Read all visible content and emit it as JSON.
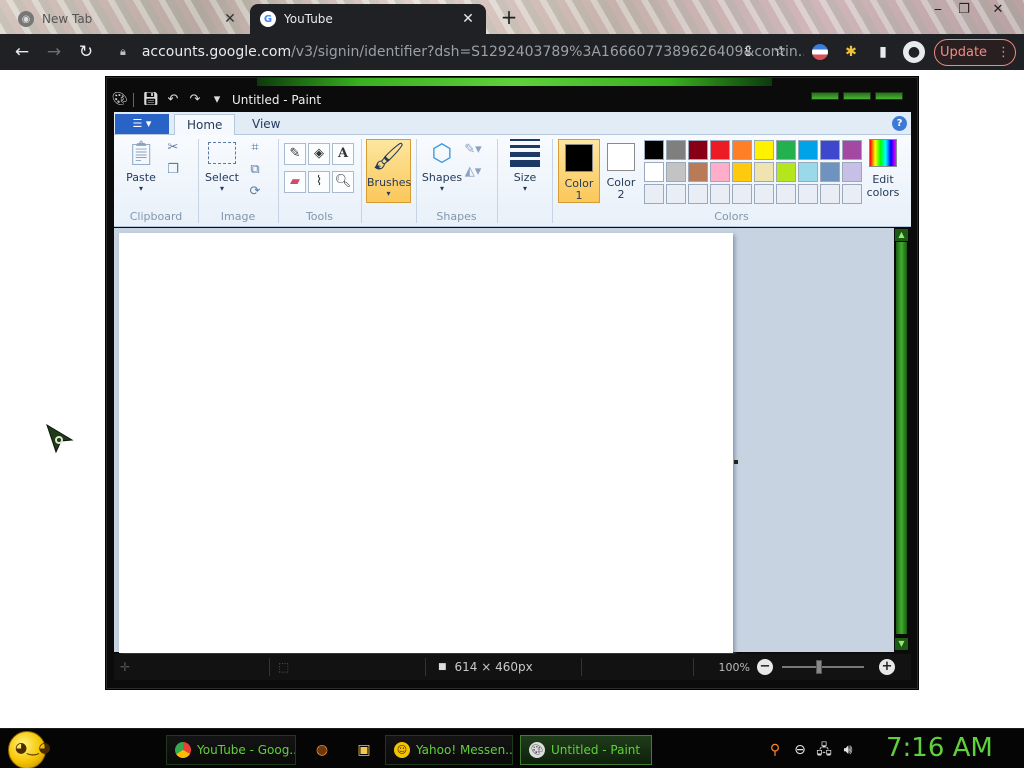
{
  "browser": {
    "tabs": [
      {
        "title": "New Tab",
        "favicon": "chrome-icon"
      },
      {
        "title": "YouTube",
        "favicon": "google-g-icon"
      }
    ],
    "new_tab_symbol": "+",
    "window_controls": [
      "⎯",
      "❐",
      "✕"
    ],
    "url_host": "accounts.google.com",
    "url_rest": "/v3/signin/identifier?dsh=S1292403789%3A1666077389626409&contin...",
    "update_label": "Update"
  },
  "paint": {
    "title": "Untitled - Paint",
    "tabs": {
      "home": "Home",
      "view": "View"
    },
    "groups": {
      "clipboard": "Clipboard",
      "image": "Image",
      "tools": "Tools",
      "shapes": "Shapes",
      "colors": "Colors"
    },
    "buttons": {
      "paste": "Paste",
      "select": "Select",
      "brushes": "Brushes",
      "shapes": "Shapes",
      "size": "Size",
      "color1_line1": "Color",
      "color1_line2": "1",
      "color2_line1": "Color",
      "color2_line2": "2",
      "edit_colors_line1": "Edit",
      "edit_colors_line2": "colors"
    },
    "color1": "#000000",
    "color2": "#ffffff",
    "palette": [
      "#000000",
      "#7f7f7f",
      "#880015",
      "#ed1c24",
      "#ff7f27",
      "#fff200",
      "#22b14c",
      "#00a2e8",
      "#3f48cc",
      "#a349a4",
      "#ffffff",
      "#c3c3c3",
      "#b97a57",
      "#ffaec9",
      "#ffc90e",
      "#efe4b0",
      "#b5e61d",
      "#99d9ea",
      "#7092be",
      "#c8bfe7",
      "#e9eef6",
      "#e9eef6",
      "#e9eef6",
      "#e9eef6",
      "#e9eef6",
      "#e9eef6",
      "#e9eef6",
      "#e9eef6",
      "#e9eef6",
      "#e9eef6"
    ],
    "status": {
      "dimensions": "614 × 460px",
      "zoom": "100%"
    }
  },
  "taskbar": {
    "items": [
      {
        "label": "YouTube - Goog...",
        "icon": "chrome-icon"
      },
      {
        "label": "Yahoo! Messen...",
        "icon": "yahoo-messenger-icon"
      },
      {
        "label": "Untitled - Paint",
        "icon": "paint-icon"
      }
    ],
    "clock": "7:16 AM"
  }
}
